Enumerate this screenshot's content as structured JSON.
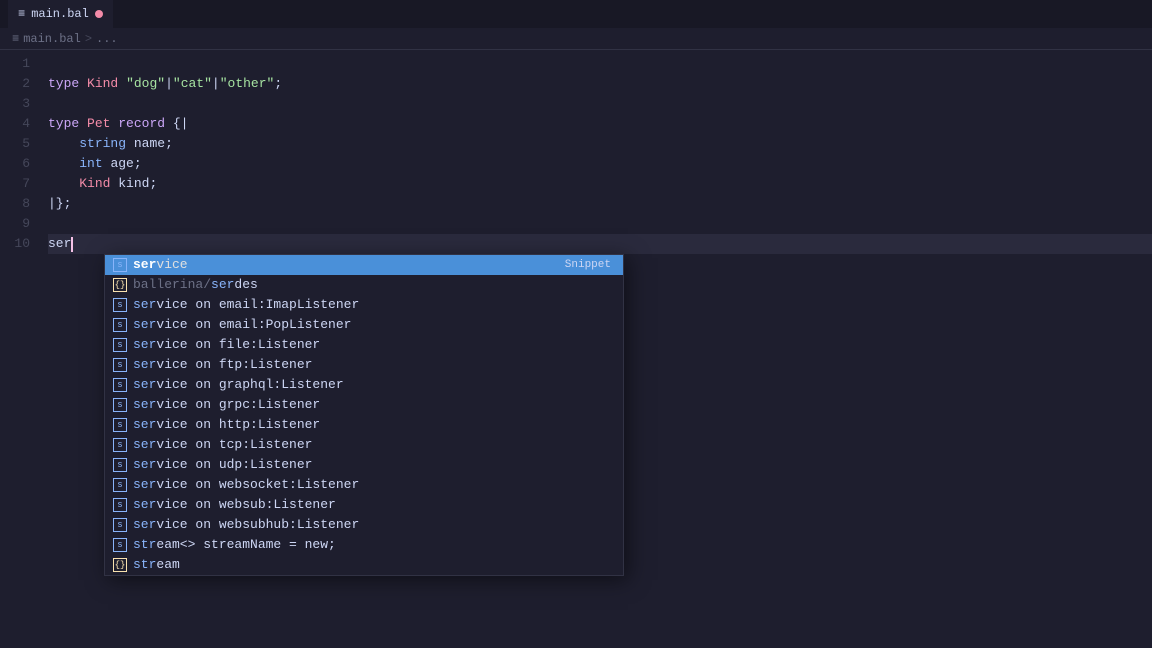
{
  "titleBar": {
    "tabLabel": "main.bal",
    "tabModified": true,
    "tabIcon": "≡"
  },
  "breadcrumb": {
    "file": "main.bal",
    "sep1": ">",
    "path": "..."
  },
  "editor": {
    "lines": [
      {
        "num": 1,
        "content": ""
      },
      {
        "num": 2,
        "content": "type Kind \"dog\"|\"cat\"|\"other\";"
      },
      {
        "num": 3,
        "content": ""
      },
      {
        "num": 4,
        "content": "type Pet record {|"
      },
      {
        "num": 5,
        "content": "    string name;"
      },
      {
        "num": 6,
        "content": "    int age;"
      },
      {
        "num": 7,
        "content": "    Kind kind;"
      },
      {
        "num": 8,
        "content": "|}"
      },
      {
        "num": 9,
        "content": ""
      },
      {
        "num": 10,
        "content": "ser",
        "cursor": true
      }
    ]
  },
  "autocomplete": {
    "items": [
      {
        "id": 1,
        "icon": "square",
        "match": "ser",
        "rest": "vice",
        "hint": "Snippet",
        "selected": true
      },
      {
        "id": 2,
        "icon": "func",
        "match": "ser",
        "rest": "",
        "prefix": "ballerina/",
        "matchMiddle": "ser",
        "restMiddle": "des",
        "type": "module"
      },
      {
        "id": 3,
        "icon": "square",
        "match": "ser",
        "rest": "vice",
        "suffix": " on email:ImapListener"
      },
      {
        "id": 4,
        "icon": "square",
        "match": "ser",
        "rest": "vice",
        "suffix": " on email:PopListener"
      },
      {
        "id": 5,
        "icon": "square",
        "match": "ser",
        "rest": "vice",
        "suffix": " on file:Listener"
      },
      {
        "id": 6,
        "icon": "square",
        "match": "ser",
        "rest": "vice",
        "suffix": " on ftp:Listener"
      },
      {
        "id": 7,
        "icon": "square",
        "match": "ser",
        "rest": "vice",
        "suffix": " on graphql:Listener"
      },
      {
        "id": 8,
        "icon": "square",
        "match": "ser",
        "rest": "vice",
        "suffix": " on grpc:Listener"
      },
      {
        "id": 9,
        "icon": "square",
        "match": "ser",
        "rest": "vice",
        "suffix": " on http:Listener"
      },
      {
        "id": 10,
        "icon": "square",
        "match": "ser",
        "rest": "vice",
        "suffix": " on tcp:Listener"
      },
      {
        "id": 11,
        "icon": "square",
        "match": "ser",
        "rest": "vice",
        "suffix": " on udp:Listener"
      },
      {
        "id": 12,
        "icon": "square",
        "match": "ser",
        "rest": "vice",
        "suffix": " on websocket:Listener"
      },
      {
        "id": 13,
        "icon": "square",
        "match": "ser",
        "rest": "vice",
        "suffix": " on websub:Listener"
      },
      {
        "id": 14,
        "icon": "square",
        "match": "ser",
        "rest": "vice",
        "suffix": " on websubhub:Listener"
      },
      {
        "id": 15,
        "icon": "square",
        "match": "str",
        "rest": "eam<> streamName = new;"
      },
      {
        "id": 16,
        "icon": "func",
        "match": "str",
        "rest": "eam"
      }
    ]
  }
}
